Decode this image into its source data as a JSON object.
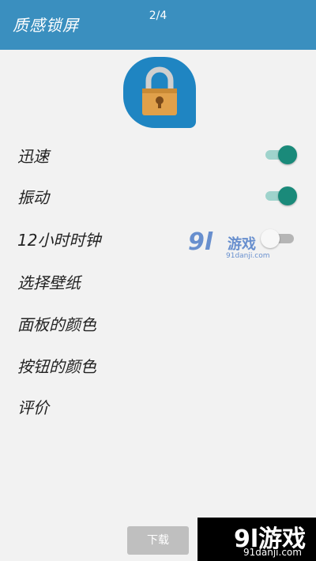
{
  "header": {
    "title": "质感锁屏",
    "pager": "2/4"
  },
  "settings": [
    {
      "label": "迅速",
      "toggle": "on"
    },
    {
      "label": "振动",
      "toggle": "on"
    },
    {
      "label": "12小时时钟",
      "toggle": "off"
    },
    {
      "label": "选择壁纸"
    },
    {
      "label": "面板的颜色"
    },
    {
      "label": "按钮的颜色"
    },
    {
      "label": "评价"
    }
  ],
  "watermark_mid": {
    "logo": "9l",
    "chars": "游戏",
    "site": "91danji.com"
  },
  "download": {
    "label": "下载"
  },
  "watermark_br": {
    "text": "9l游戏",
    "site": "91danji.com"
  },
  "colors": {
    "header": "#3a8fbf",
    "toggle_on": "#1a8a7a",
    "icon_bg": "#1f85c2",
    "lock_body": "#e0a04a"
  }
}
